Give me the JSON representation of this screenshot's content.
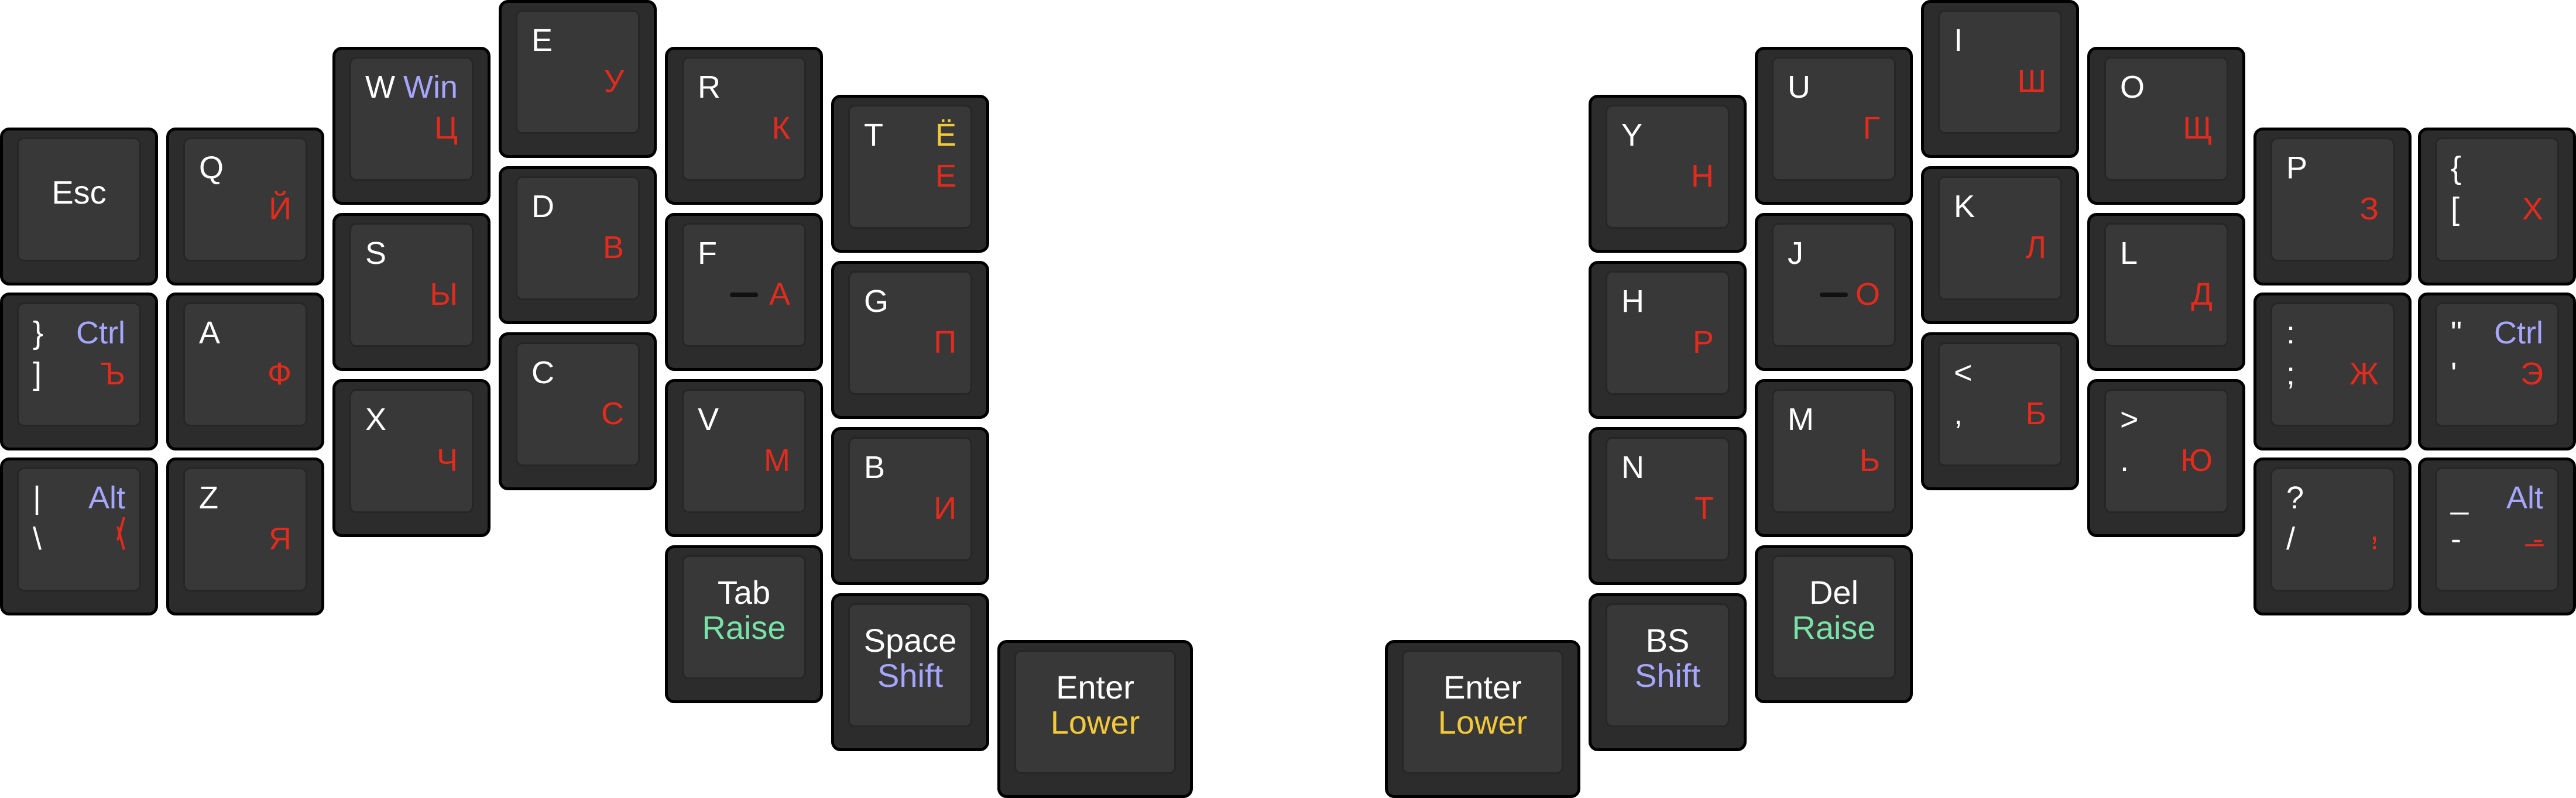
{
  "colors": {
    "background": "#ffffff",
    "key": "#2c2c2c",
    "keycap": "#383838",
    "latin": "#ffffff",
    "cyrillic": "#e22b1d",
    "modifier": "#a6a6ff",
    "yo_lower": "#f2c93a",
    "raise": "#79e2a6"
  },
  "keys": [
    {
      "id": "esc",
      "center": "Esc"
    },
    {
      "id": "q",
      "tl": "Q",
      "br": "Й"
    },
    {
      "id": "w",
      "tl": "W",
      "tr": "Win",
      "br": "Ц"
    },
    {
      "id": "e",
      "tl": "E",
      "br": "У"
    },
    {
      "id": "r",
      "tl": "R",
      "br": "К"
    },
    {
      "id": "t",
      "tl": "T",
      "tr": "Ё",
      "br": "Е"
    },
    {
      "id": "rbrace",
      "tl": "}",
      "tr": "Ctrl",
      "bl": "]",
      "br": "Ъ"
    },
    {
      "id": "a",
      "tl": "A",
      "br": "Ф"
    },
    {
      "id": "s",
      "tl": "S",
      "br": "Ы"
    },
    {
      "id": "d",
      "tl": "D",
      "br": "В"
    },
    {
      "id": "f",
      "tl": "F",
      "br": "А",
      "bump": true
    },
    {
      "id": "g",
      "tl": "G",
      "br": "П"
    },
    {
      "id": "pipe",
      "tl": "|",
      "tr": "Alt",
      "mr": "/",
      "bl": "\\",
      "br": "\\"
    },
    {
      "id": "z",
      "tl": "Z",
      "br": "Я"
    },
    {
      "id": "x",
      "tl": "X",
      "br": "Ч"
    },
    {
      "id": "c",
      "tl": "C",
      "br": "С"
    },
    {
      "id": "v",
      "tl": "V",
      "br": "М"
    },
    {
      "id": "b",
      "tl": "B",
      "br": "И"
    },
    {
      "id": "tab",
      "center": "Tab",
      "center2": "Raise"
    },
    {
      "id": "space",
      "center": "Space",
      "center2": "Shift"
    },
    {
      "id": "enter-left",
      "center": "Enter",
      "center2": "Lower"
    },
    {
      "id": "y",
      "tl": "Y",
      "br": "Н"
    },
    {
      "id": "u",
      "tl": "U",
      "br": "Г"
    },
    {
      "id": "i",
      "tl": "I",
      "br": "Ш"
    },
    {
      "id": "o",
      "tl": "O",
      "br": "Щ"
    },
    {
      "id": "p",
      "tl": "P",
      "br": "З"
    },
    {
      "id": "lbrace",
      "tl": "{",
      "bl": "[",
      "br": "Х"
    },
    {
      "id": "h",
      "tl": "H",
      "br": "Р"
    },
    {
      "id": "j",
      "tl": "J",
      "br": "О",
      "bump": true
    },
    {
      "id": "k",
      "tl": "K",
      "br": "Л"
    },
    {
      "id": "l",
      "tl": "L",
      "br": "Д"
    },
    {
      "id": "semicolon",
      "tl": ":",
      "bl": ";",
      "br": "Ж"
    },
    {
      "id": "quote",
      "tl": "\"",
      "tr": "Ctrl",
      "bl": "'",
      "br": "Э"
    },
    {
      "id": "n",
      "tl": "N",
      "br": "Т"
    },
    {
      "id": "m",
      "tl": "M",
      "br": "Ь"
    },
    {
      "id": "comma",
      "tl": "<",
      "bl": ",",
      "br": "Б"
    },
    {
      "id": "period",
      "tl": ">",
      "bl": ".",
      "br": "Ю"
    },
    {
      "id": "slash",
      "tl": "?",
      "mr": ",",
      "bl": "/",
      "br": "."
    },
    {
      "id": "minus",
      "tl": "_",
      "tr": "Alt",
      "mr": "_",
      "bl": "-",
      "br": "-"
    },
    {
      "id": "enter-right",
      "center": "Enter",
      "center2": "Lower"
    },
    {
      "id": "bs",
      "center": "BS",
      "center2": "Shift"
    },
    {
      "id": "del",
      "center": "Del",
      "center2": "Raise"
    }
  ]
}
